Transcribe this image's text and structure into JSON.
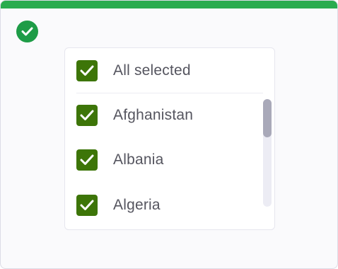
{
  "colors": {
    "accent_bar": "#2aac4e",
    "status_badge": "#1e9c47",
    "checkbox_fill": "#3d7508",
    "label_text": "#55555f"
  },
  "status": {
    "icon": "check-circle-icon",
    "state": "success"
  },
  "select_all": {
    "label": "All selected",
    "checked": true
  },
  "options": [
    {
      "label": "Afghanistan",
      "checked": true
    },
    {
      "label": "Albania",
      "checked": true
    },
    {
      "label": "Algeria",
      "checked": true
    }
  ],
  "scrollbar": {
    "scroll_position": 0.0
  }
}
